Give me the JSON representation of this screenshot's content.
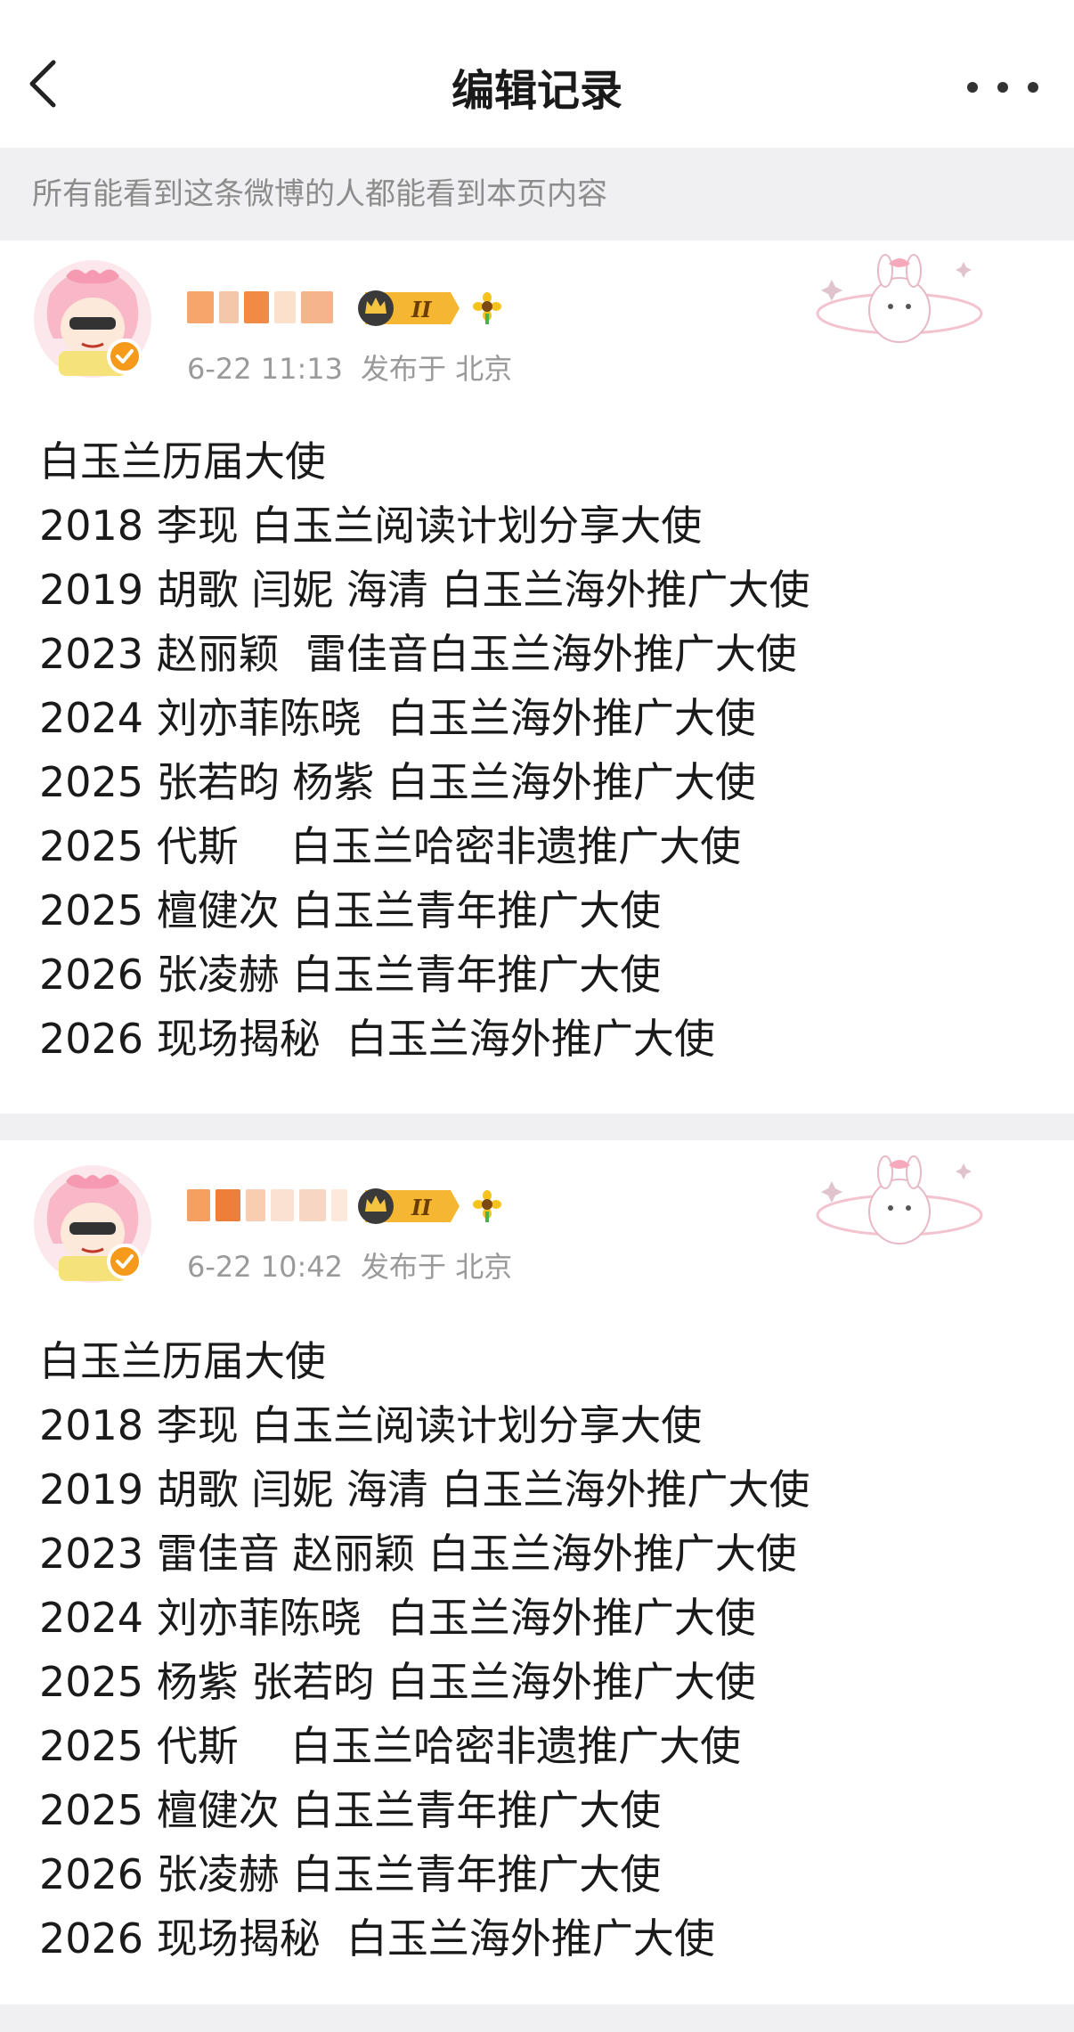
{
  "header": {
    "title": "编辑记录",
    "back_icon": "chevron-left-icon",
    "more_icon": "more-horizontal-icon"
  },
  "notice": {
    "text": "所有能看到这条微博的人都能看到本页内容"
  },
  "records": [
    {
      "time": "6-22 11:13",
      "location_label": "发布于 北京",
      "lines": [
        "白玉兰历届大使",
        "2018 李现 白玉兰阅读计划分享大使",
        "2019 胡歌 闫妮 海清 白玉兰海外推广大使",
        "2023 赵丽颖  雷佳音白玉兰海外推广大使",
        "2024 刘亦菲陈晓  白玉兰海外推广大使",
        "2025 张若昀 杨紫 白玉兰海外推广大使",
        "2025 代斯    白玉兰哈密非遗推广大使",
        "2025 檀健次 白玉兰青年推广大使",
        "2026 张凌赫 白玉兰青年推广大使",
        "2026 现场揭秘  白玉兰海外推广大使"
      ]
    },
    {
      "time": "6-22 10:42",
      "location_label": "发布于 北京",
      "lines": [
        "白玉兰历届大使",
        "2018 李现 白玉兰阅读计划分享大使",
        "2019 胡歌 闫妮 海清 白玉兰海外推广大使",
        "2023 雷佳音 赵丽颖 白玉兰海外推广大使",
        "2024 刘亦菲陈晓  白玉兰海外推广大使",
        "2025 杨紫 张若昀 白玉兰海外推广大使",
        "2025 代斯    白玉兰哈密非遗推广大使",
        "2025 檀健次 白玉兰青年推广大使",
        "2026 张凌赫 白玉兰青年推广大使",
        "2026 现场揭秘  白玉兰海外推广大使"
      ]
    }
  ],
  "colors": {
    "text_primary": "#1a1a1a",
    "text_secondary": "#9a9a9a",
    "notice_bg": "#f0f0f2",
    "badge_gold": "#f5b731",
    "verified_orange": "#f59a1b"
  }
}
